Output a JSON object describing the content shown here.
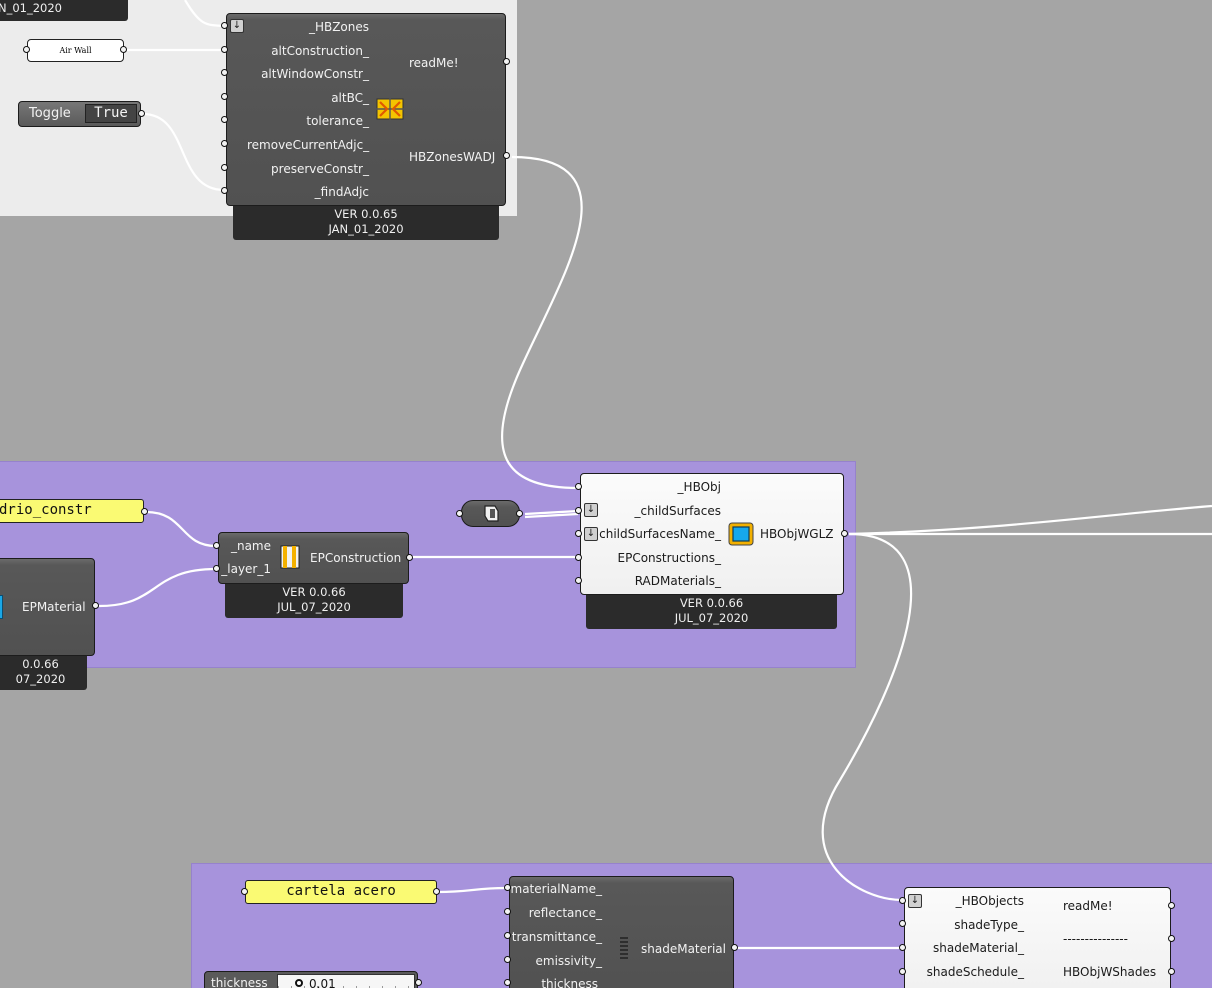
{
  "canvas": {
    "colors": {
      "background": "#a5a5a5",
      "group_purple": "#a793dc",
      "group_gray": "#ececec",
      "panel_yellow": "#fafa73",
      "wire": "#ffffff"
    }
  },
  "top_left_remnant": {
    "date": "N_01_2020"
  },
  "air_wall_panel": {
    "text": "Air Wall"
  },
  "toggle": {
    "label": "Toggle",
    "value": "True"
  },
  "adjacency_component": {
    "inputs": [
      "_HBZones",
      "altConstruction_",
      "altWindowConstr_",
      "altBC_",
      "tolerance_",
      "removeCurrentAdjc_",
      "preserveConstr_",
      "_findAdjc"
    ],
    "outputs": [
      "readMe!",
      "HBZonesWADJ"
    ],
    "icon": "adjacency-icon",
    "version": "VER 0.0.65",
    "date": "JAN_01_2020"
  },
  "vidrio_panel": {
    "text": "drio_constr"
  },
  "ep_material_component": {
    "output": "EPMaterial",
    "version": "0.0.66",
    "date": "07_2020",
    "icon": "material-icon"
  },
  "ep_construction_component": {
    "inputs": [
      "_name",
      "_layer_1"
    ],
    "output": "EPConstruction",
    "icon": "construction-icon",
    "version": "VER 0.0.66",
    "date": "JUL_07_2020"
  },
  "relay_component": {
    "icon": "relay-icon"
  },
  "glazing_component": {
    "inputs": [
      "_HBObj",
      "_childSurfaces",
      "childSurfacesName_",
      "EPConstructions_",
      "RADMaterials_"
    ],
    "output": "HBObjWGLZ",
    "icon": "window-icon",
    "version": "VER 0.0.66",
    "date": "JUL_07_2020"
  },
  "cartela_panel": {
    "text": "cartela acero"
  },
  "thickness_slider": {
    "label": "thickness",
    "value": "0.01"
  },
  "shade_material_component": {
    "inputs": [
      "materialName_",
      "reflectance_",
      "transmittance_",
      "emissivity_",
      "thickness"
    ],
    "output": "shadeMaterial",
    "icon": "shade-material-icon"
  },
  "shades_component": {
    "inputs": [
      "_HBObjects",
      "shadeType_",
      "shadeMaterial_",
      "shadeSchedule_"
    ],
    "outputs": [
      "readMe!",
      "---------------",
      "HBObjWShades"
    ]
  }
}
